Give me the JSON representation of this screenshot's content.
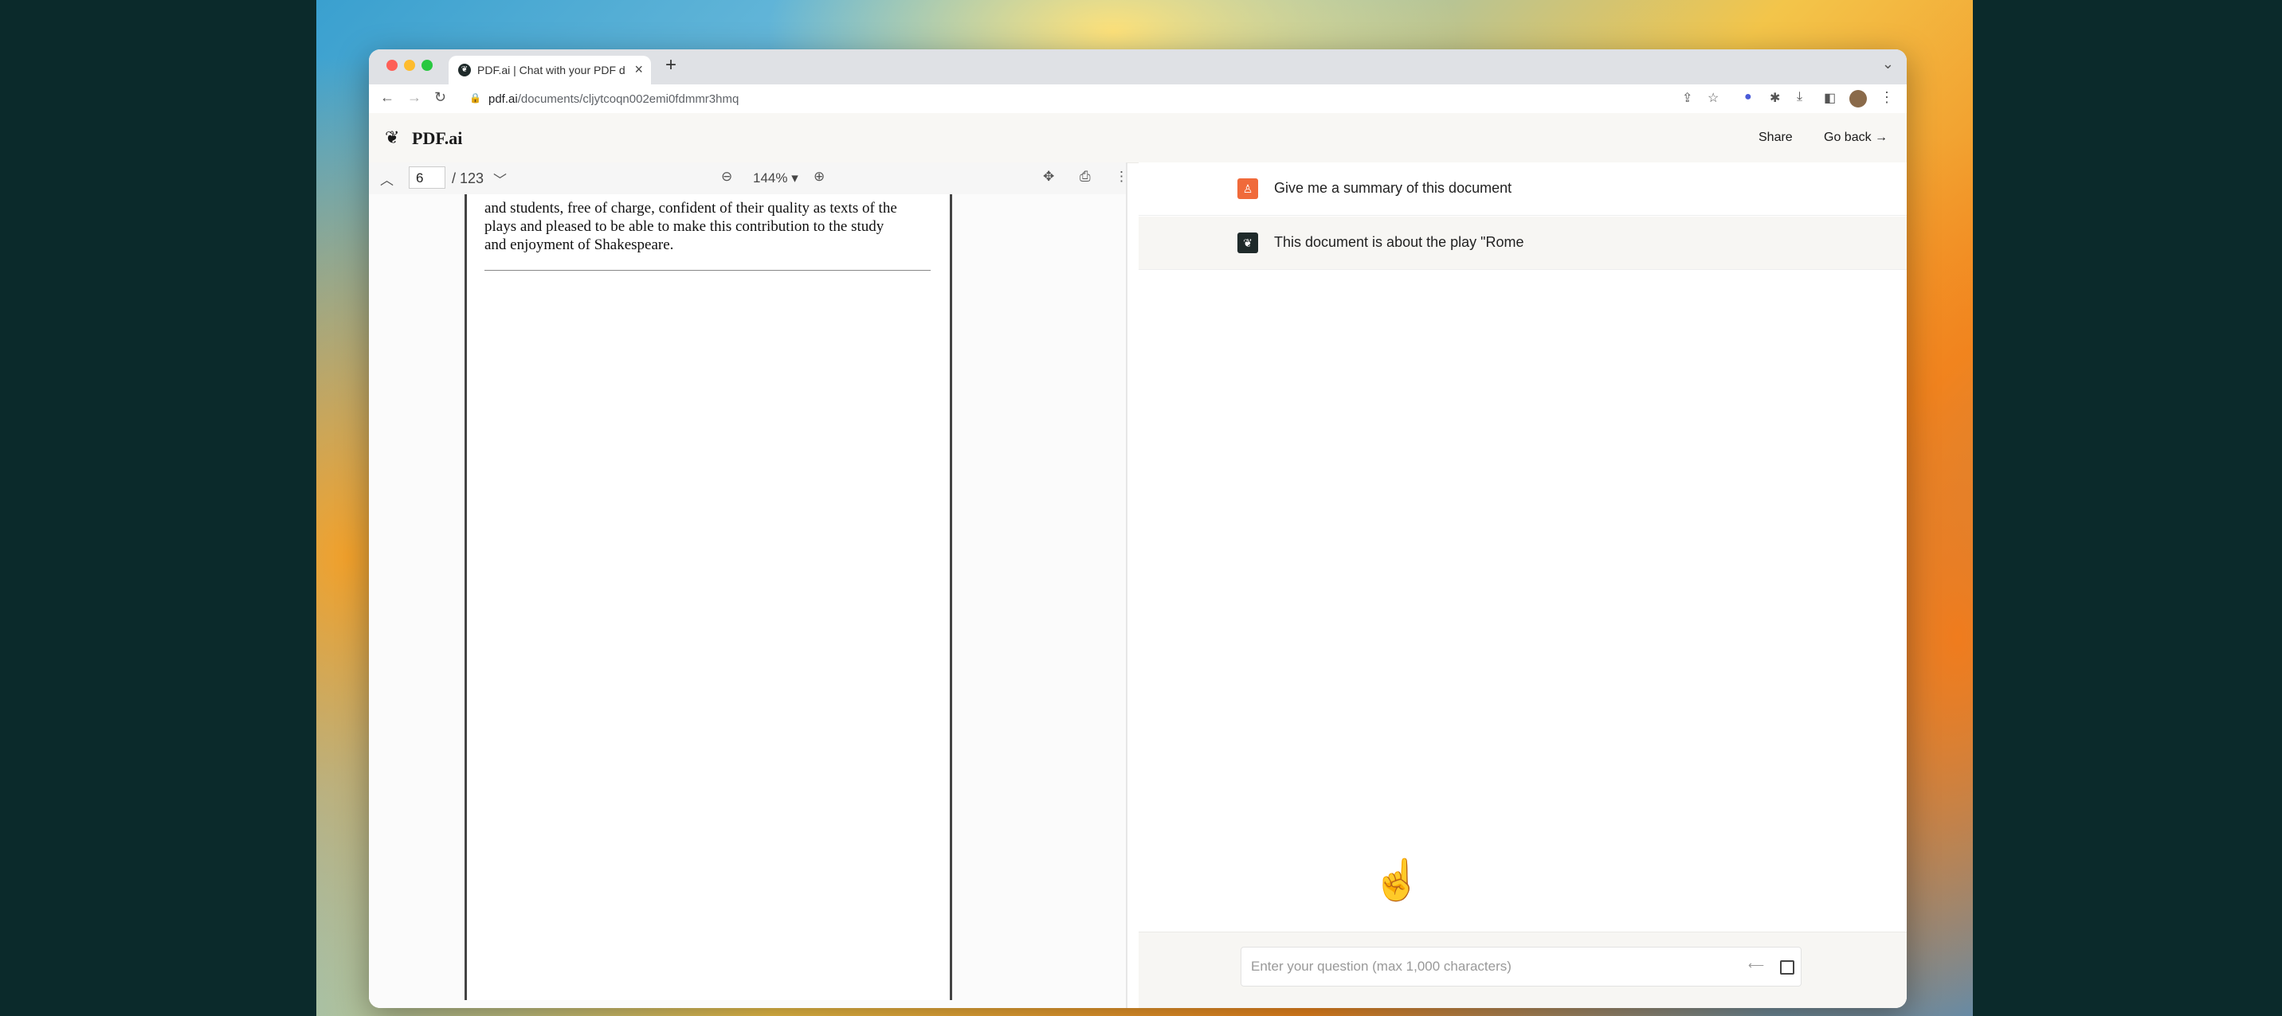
{
  "browser": {
    "tab_title": "PDF.ai | Chat with your PDF do",
    "tab_close": "×",
    "new_tab": "+",
    "url_host": "pdf.ai",
    "url_path": "/documents/cljytcoqn002emi0fdmmr3hmq"
  },
  "header": {
    "logo_text": "PDF.ai",
    "share_label": "Share",
    "go_back_label": "Go back →"
  },
  "pdf_viewer": {
    "current_page": "6",
    "total_pages": "/ 123",
    "zoom_level": "144% ▾",
    "page_lines": [
      "and students, free of charge, confident of their quality as texts of the",
      "plays and pleased to be able to make this contribution to the study",
      "and enjoyment of Shakespeare."
    ]
  },
  "chat": {
    "user_message": "Give me a summary of this document",
    "bot_message": "This document is about the play \"Rome",
    "input_placeholder": "Enter your question (max 1,000 characters)"
  },
  "colors": {
    "user_avatar": "#f06a3a",
    "bot_avatar": "#1f2a2a",
    "panel_bg": "#f7f6f3"
  }
}
